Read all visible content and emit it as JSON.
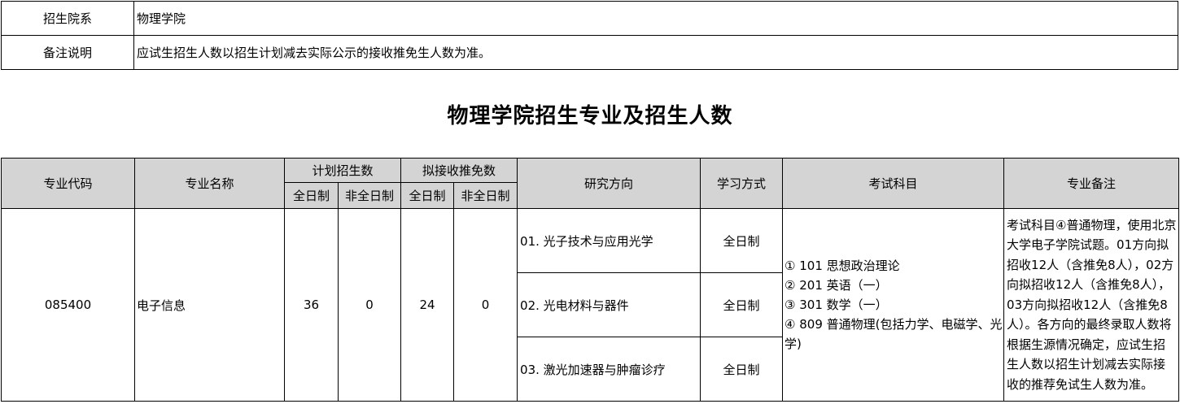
{
  "info": {
    "rows": [
      {
        "label": "招生院系",
        "value": "物理学院"
      },
      {
        "label": "备注说明",
        "value": "应试生招生人数以招生计划减去实际公示的接收推免生人数为准。"
      }
    ]
  },
  "title": "物理学院招生专业及招生人数",
  "table": {
    "headers": {
      "code": "专业代码",
      "name": "专业名称",
      "plan": "计划招生数",
      "exempt": "拟接收推免数",
      "direction": "研究方向",
      "mode": "学习方式",
      "exam": "考试科目",
      "note": "专业备注",
      "plan_full": "全日制",
      "plan_part": "非全日制",
      "exempt_full": "全日制",
      "exempt_part": "非全日制"
    },
    "row": {
      "code": "085400",
      "name": "电子信息",
      "plan_full": "36",
      "plan_part": "0",
      "exempt_full": "24",
      "exempt_part": "0",
      "directions": [
        {
          "name": "01. 光子技术与应用光学",
          "mode": "全日制"
        },
        {
          "name": "02. 光电材料与器件",
          "mode": "全日制"
        },
        {
          "name": "03. 激光加速器与肿瘤诊疗",
          "mode": "全日制"
        }
      ],
      "exam": [
        "① 101 思想政治理论",
        "② 201 英语（一）",
        "③ 301 数学（一）",
        "④ 809 普通物理(包括力学、电磁学、光学)"
      ],
      "note": "考试科目④普通物理，使用北京大学电子学院试题。01方向拟招收12人（含推免8人），02方向拟招收12人（含推免8人），03方向拟招收12人（含推免8人）。各方向的最终录取人数将根据生源情况确定，应试生招生人数以招生计划减去实际接收的推荐免试生人数为准。"
    }
  }
}
